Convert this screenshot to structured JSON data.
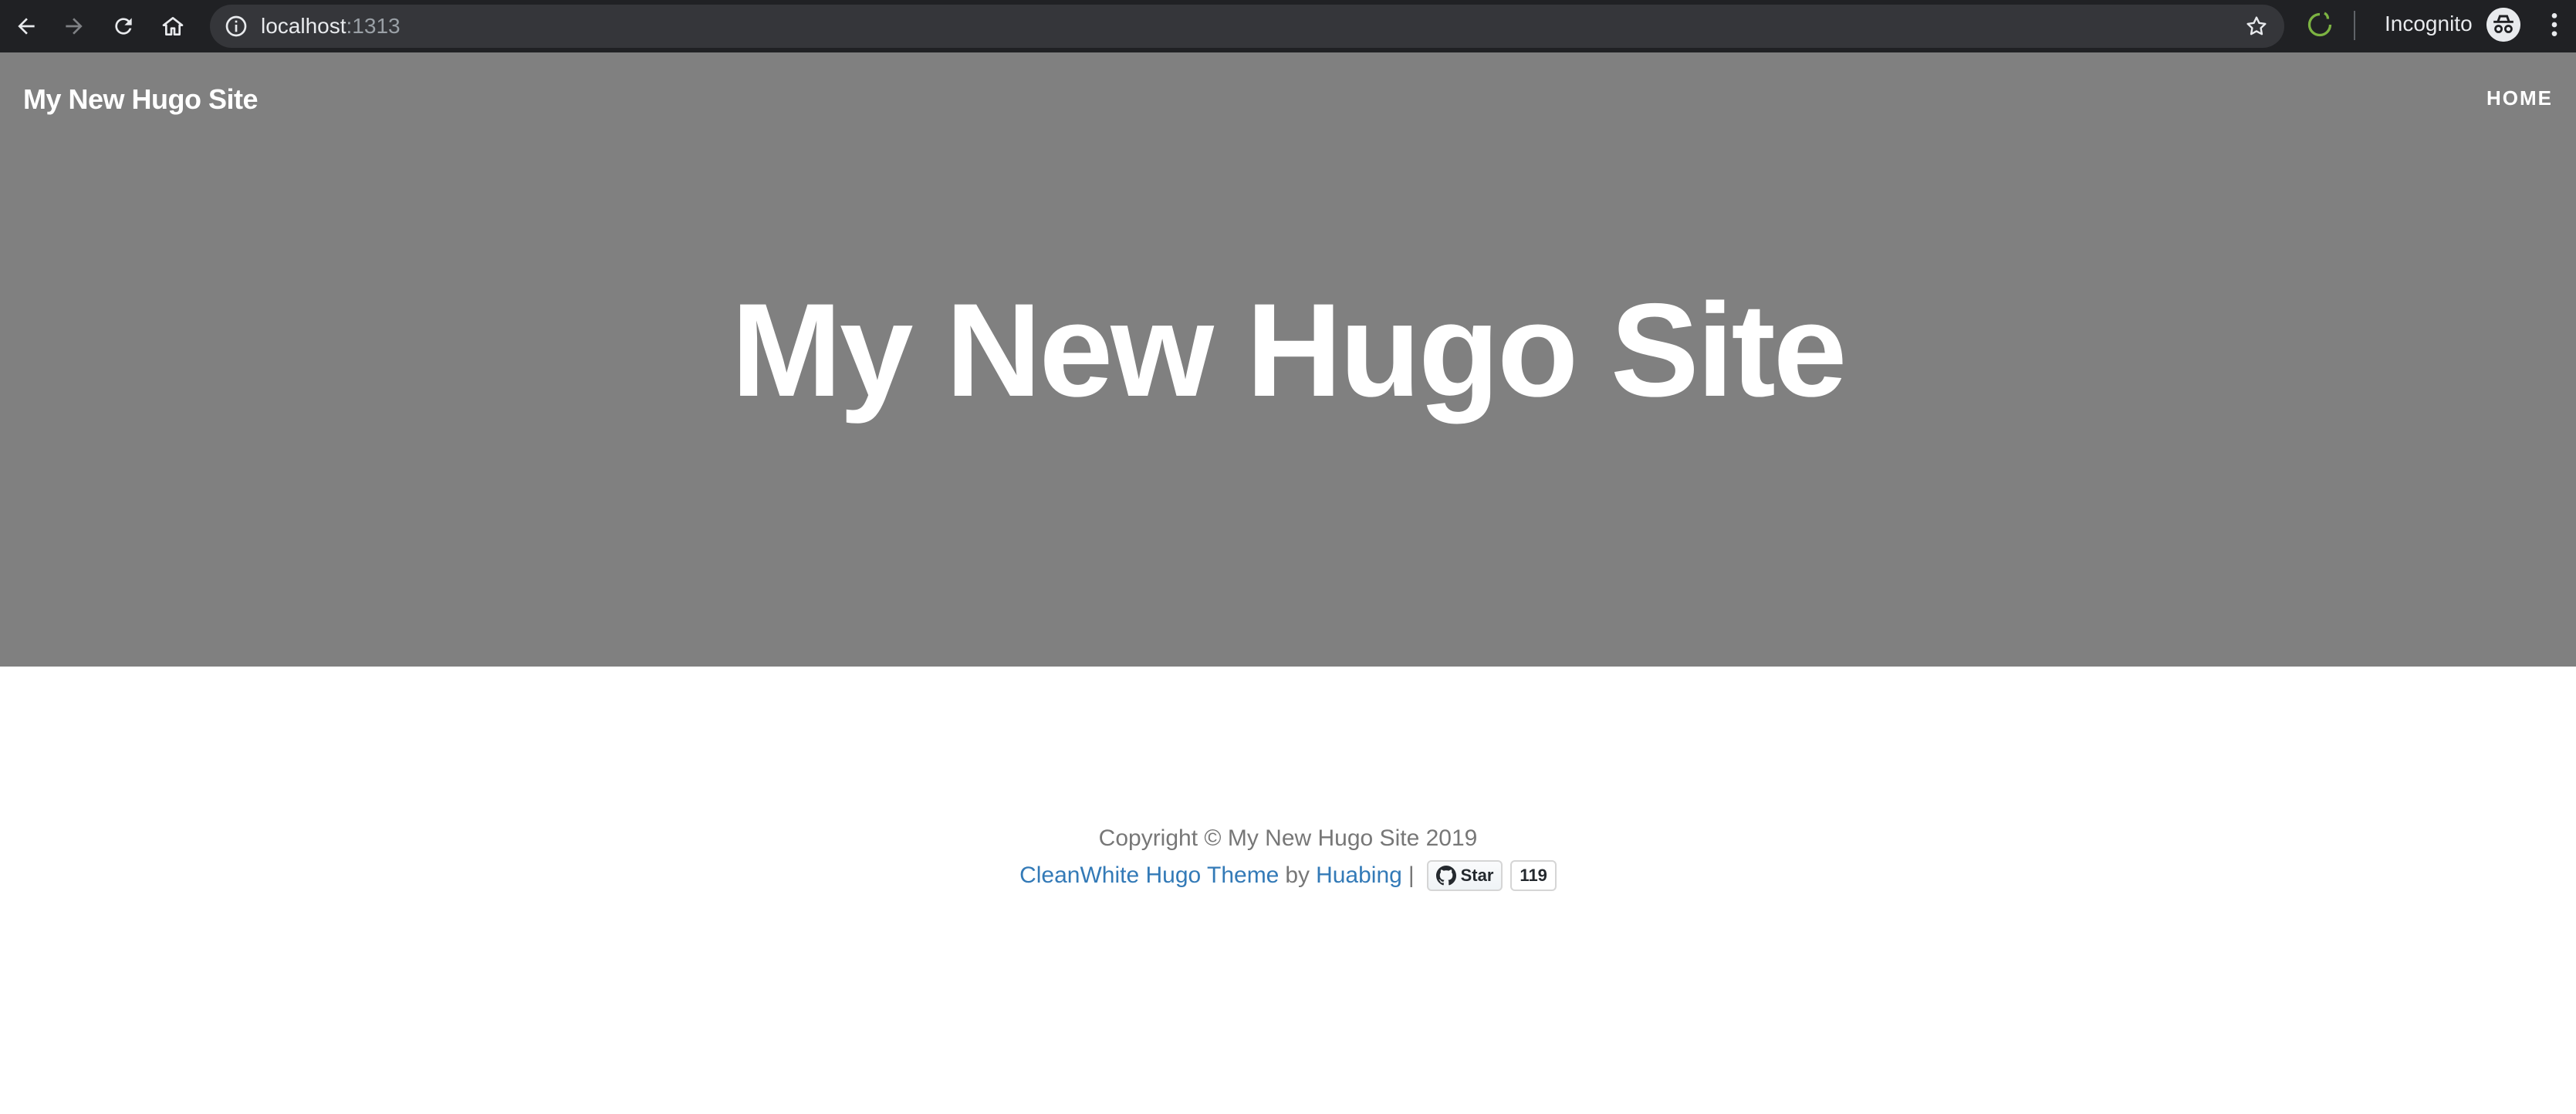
{
  "browser": {
    "url_host": "localhost",
    "url_port": ":1313",
    "profile_label": "Incognito",
    "icons": {
      "back": "arrow-left-icon",
      "forward": "arrow-right-icon",
      "reload": "reload-icon",
      "home": "home-icon",
      "site_info": "info-icon",
      "bookmark": "star-icon",
      "extension": "extension-icon",
      "incognito": "incognito-icon",
      "menu": "kebab-menu-icon"
    }
  },
  "site": {
    "brand": "My New Hugo Site",
    "nav": [
      {
        "label": "HOME"
      }
    ],
    "hero_title": "My New Hugo Site",
    "hero_color": "#808080"
  },
  "footer": {
    "copyright": "Copyright © My New Hugo Site 2019",
    "theme_link": "CleanWhite Hugo Theme",
    "by_text": "by",
    "author_link": "Huabing",
    "separator": "|",
    "star_label": "Star",
    "star_count": "119",
    "link_color": "#337ab7"
  }
}
